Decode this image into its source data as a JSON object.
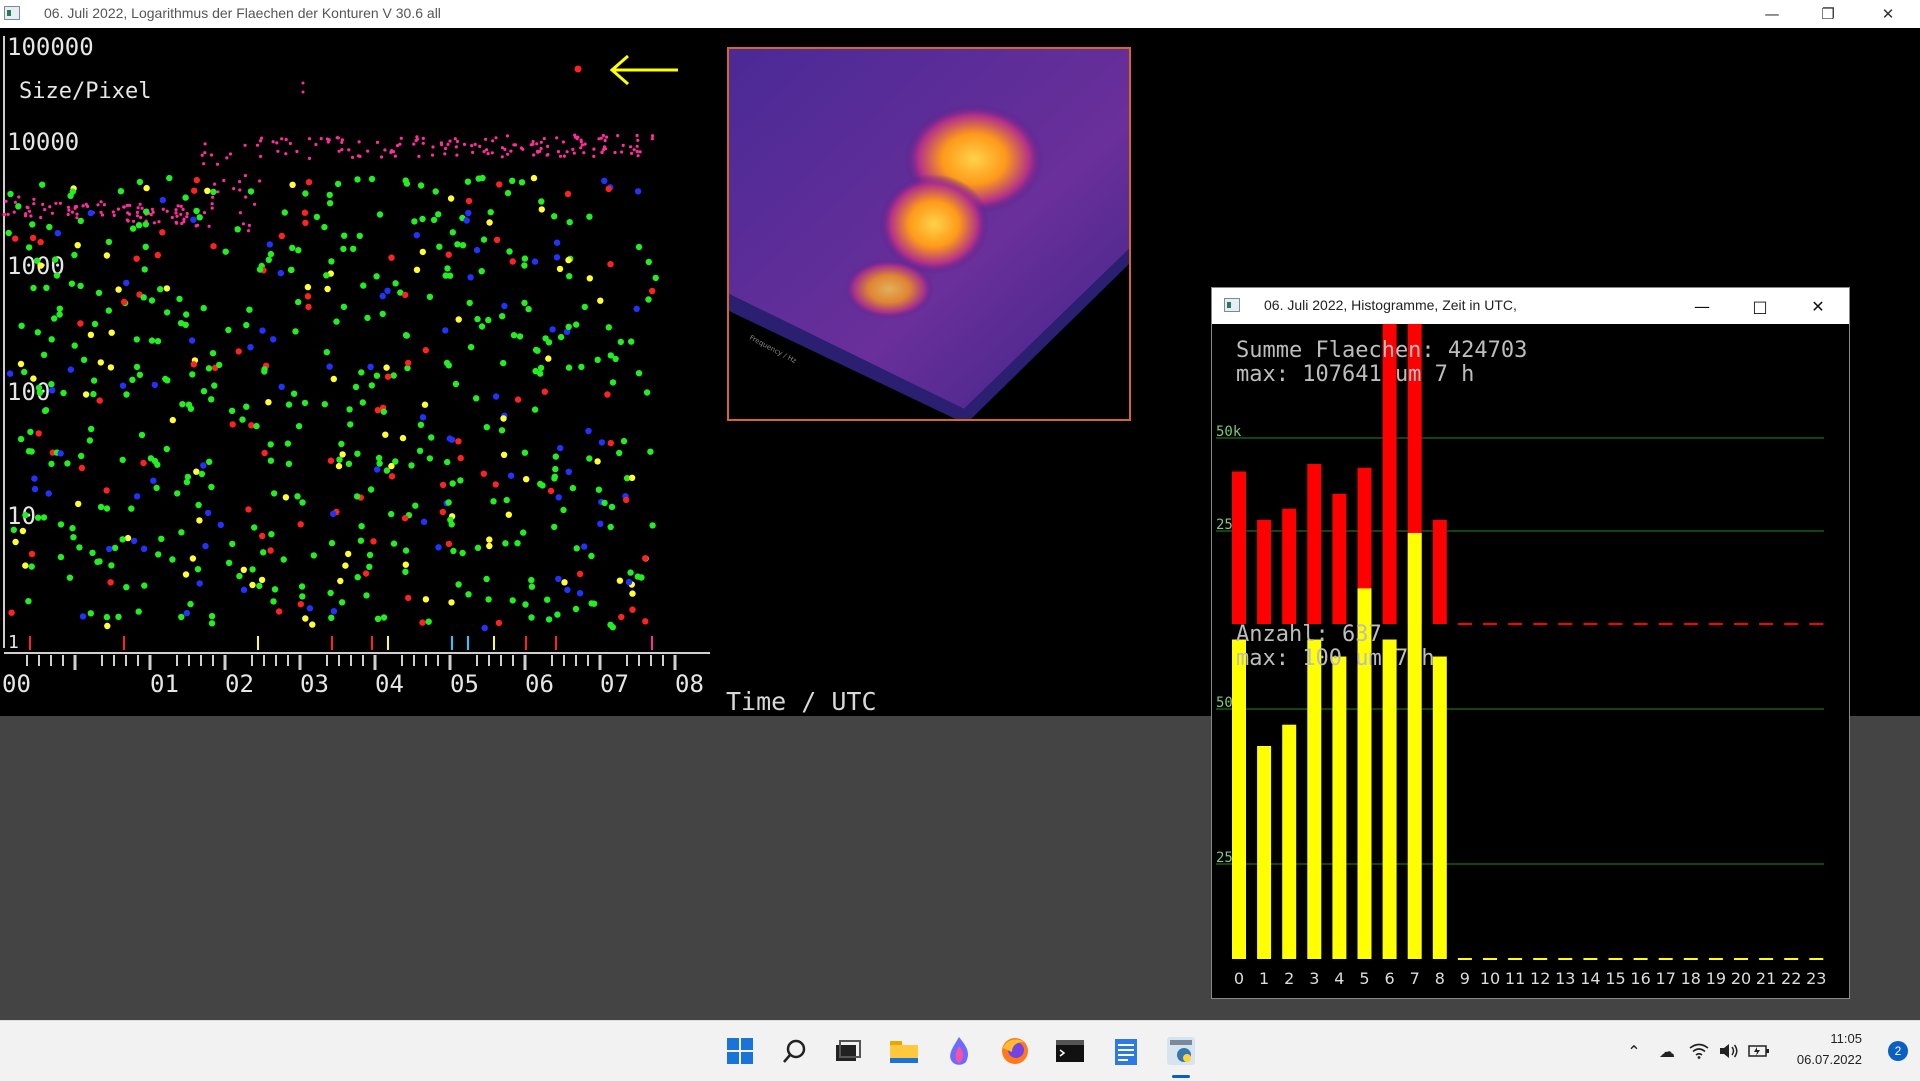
{
  "window": {
    "title": "06. Juli 2022, Logarithmus der Flaechen der Konturen V 30.6 all"
  },
  "scatter": {
    "y_unit_label": "Size/Pixel",
    "y_ticks": [
      "100000",
      "10000",
      "1000",
      "100",
      "10",
      "1"
    ],
    "x_ticks": [
      "00",
      "01",
      "02",
      "03",
      "04",
      "05",
      "06",
      "07",
      "08"
    ],
    "x_axis_label": "Time / UTC",
    "arrow_color": "#ffff00"
  },
  "histogram_window": {
    "title": "06. Juli 2022, Histogramme, Zeit in UTC,"
  },
  "chart_data": [
    {
      "type": "bar",
      "name": "Flaechen",
      "title_line1": "Summe Flaechen: 424703",
      "title_line2": "max: 107641 um 7 h",
      "categories": [
        "0",
        "1",
        "2",
        "3",
        "4",
        "5",
        "6",
        "7",
        "8",
        "9",
        "10",
        "11",
        "12",
        "13",
        "14",
        "15",
        "16",
        "17",
        "18",
        "19",
        "20",
        "21",
        "22",
        "23"
      ],
      "values": [
        41000,
        28000,
        31000,
        43000,
        35000,
        42000,
        84000,
        107641,
        28000,
        0,
        0,
        0,
        0,
        0,
        0,
        0,
        0,
        0,
        0,
        0,
        0,
        0,
        0,
        0
      ],
      "y_tick_labels": [
        "25k",
        "50k"
      ],
      "y_ticks": [
        25000,
        50000
      ],
      "color": "#ff0000"
    },
    {
      "type": "bar",
      "name": "Anzahl",
      "title_line1": "Anzahl: 637",
      "title_line2": "max: 100 um 7 h",
      "categories": [
        "0",
        "1",
        "2",
        "3",
        "4",
        "5",
        "6",
        "7",
        "8",
        "9",
        "10",
        "11",
        "12",
        "13",
        "14",
        "15",
        "16",
        "17",
        "18",
        "19",
        "20",
        "21",
        "22",
        "23"
      ],
      "values": [
        75,
        50,
        55,
        75,
        71,
        87,
        75,
        100,
        71,
        0,
        0,
        0,
        0,
        0,
        0,
        0,
        0,
        0,
        0,
        0,
        0,
        0,
        0,
        0
      ],
      "y_tick_labels": [
        "25",
        "50"
      ],
      "y_ticks": [
        25,
        50
      ],
      "color": "#ffff00"
    }
  ],
  "taskbar": {
    "time": "11:05",
    "date": "06.07.2022",
    "notification_count": "2"
  }
}
